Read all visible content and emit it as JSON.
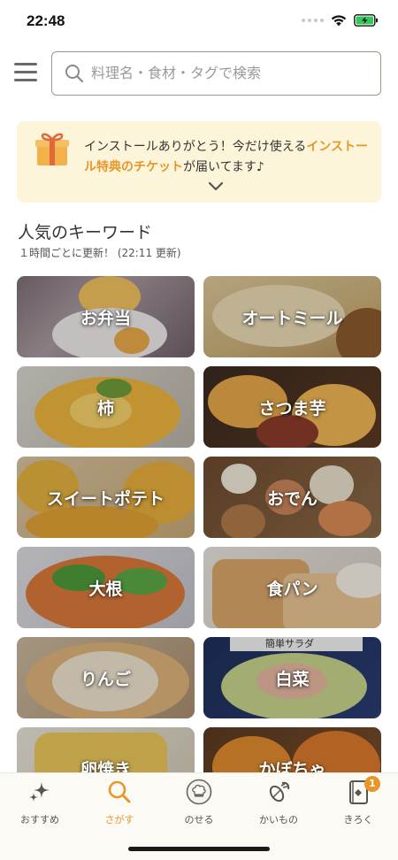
{
  "status_bar": {
    "time": "22:48"
  },
  "search": {
    "placeholder": "料理名・食材・タグで検索"
  },
  "promo": {
    "text_before": "インストールありがとう！今だけ使える",
    "text_highlight": "インストール特典のチケット",
    "text_after": "が届いてます♪"
  },
  "keywords": {
    "title": "人気のキーワード",
    "subtitle": "１時間ごとに更新！ (22:11 更新)",
    "items": [
      {
        "label": "お弁当"
      },
      {
        "label": "オートミール"
      },
      {
        "label": "柿"
      },
      {
        "label": "さつま芋"
      },
      {
        "label": "スイートポテト"
      },
      {
        "label": "おでん"
      },
      {
        "label": "大根"
      },
      {
        "label": "食パン"
      },
      {
        "label": "りんご"
      },
      {
        "label": "白菜"
      },
      {
        "label": "卵焼き"
      },
      {
        "label": "かぼちゃ"
      }
    ],
    "photo_caption": "簡単サラダ"
  },
  "tab_bar": {
    "tabs": [
      {
        "label": "おすすめ",
        "icon": "sparkle-icon"
      },
      {
        "label": "さがす",
        "icon": "search-icon"
      },
      {
        "label": "のせる",
        "icon": "chef-hat-icon"
      },
      {
        "label": "かいもの",
        "icon": "vegetables-icon"
      },
      {
        "label": "きろく",
        "icon": "notebook-icon"
      }
    ],
    "active": "さがす",
    "badge_count": "1"
  },
  "colors": {
    "accent": "#e8962a",
    "promo_background": "#fdf5da",
    "tab_bar_background": "#fbfaf5"
  }
}
